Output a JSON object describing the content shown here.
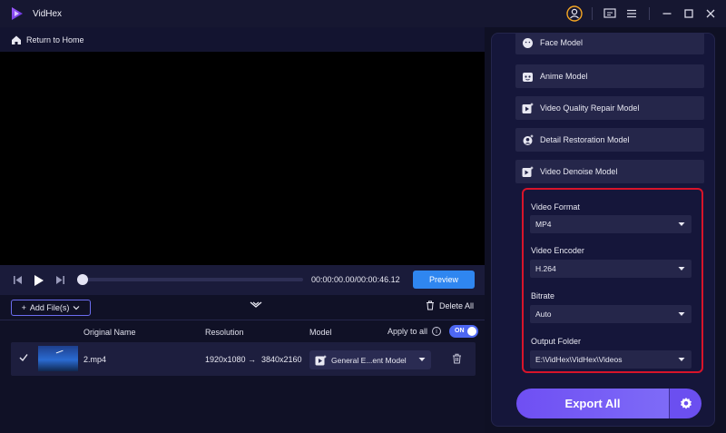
{
  "app": {
    "title": "VidHex",
    "brand_color": "#7c3aed"
  },
  "titlebar": {
    "icons": [
      "user-icon",
      "feedback-icon",
      "menu-icon",
      "minimize-icon",
      "maximize-icon",
      "close-icon"
    ]
  },
  "topbar": {
    "home_label": "Return to Home"
  },
  "player": {
    "time": "00:00:00.00/00:00:46.12",
    "preview_label": "Preview",
    "progress": 0
  },
  "filebar": {
    "add_label": "Add File(s)",
    "delete_all_label": "Delete All"
  },
  "table": {
    "headers": {
      "original_name": "Original Name",
      "resolution": "Resolution",
      "model": "Model"
    },
    "apply_all_label": "Apply to all",
    "toggle_label": "ON",
    "rows": [
      {
        "name": "2.mp4",
        "resolution_from": "1920x1080",
        "arrow": "→",
        "resolution_to": "3840x2160",
        "model": "General E...ent Model"
      }
    ]
  },
  "models": [
    {
      "label": "Face Model",
      "icon": "face-icon"
    },
    {
      "label": "Anime Model",
      "icon": "anime-icon"
    },
    {
      "label": "Video Quality Repair Model",
      "icon": "repair-icon"
    },
    {
      "label": "Detail Restoration Model",
      "icon": "detail-icon"
    },
    {
      "label": "Video Denoise Model",
      "icon": "denoise-icon"
    }
  ],
  "settings": {
    "format": {
      "label": "Video Format",
      "value": "MP4"
    },
    "encoder": {
      "label": "Video Encoder",
      "value": "H.264"
    },
    "bitrate": {
      "label": "Bitrate",
      "value": "Auto"
    },
    "folder": {
      "label": "Output Folder",
      "value": "E:\\VidHex\\VidHex\\Videos"
    }
  },
  "export": {
    "label": "Export All"
  },
  "colors": {
    "accent": "#6f4ff3",
    "preview": "#2f86f0",
    "highlight": "#d8142a",
    "toggle": "#4d67f2"
  }
}
